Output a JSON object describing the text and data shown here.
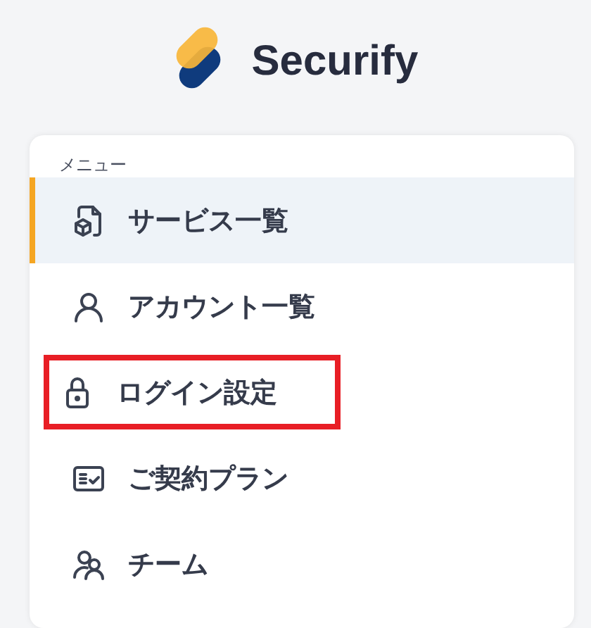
{
  "app": {
    "name": "Securify"
  },
  "menu": {
    "heading": "メニュー",
    "items": [
      {
        "label": "サービス一覧",
        "selected": true,
        "highlighted": false
      },
      {
        "label": "アカウント一覧",
        "selected": false,
        "highlighted": false
      },
      {
        "label": "ログイン設定",
        "selected": false,
        "highlighted": true
      },
      {
        "label": "ご契約プラン",
        "selected": false,
        "highlighted": false
      },
      {
        "label": "チーム",
        "selected": false,
        "highlighted": false
      }
    ]
  }
}
